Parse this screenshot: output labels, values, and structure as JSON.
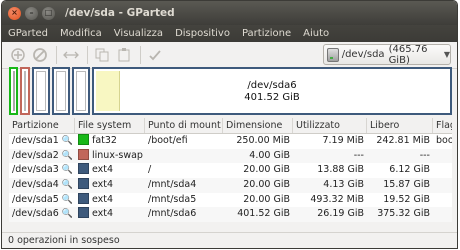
{
  "window": {
    "title": "/dev/sda - GParted"
  },
  "menu": [
    "GParted",
    "Modifica",
    "Visualizza",
    "Dispositivo",
    "Partizione",
    "Aiuto"
  ],
  "device": {
    "label": "/dev/sda",
    "size": "(465.76 GiB)"
  },
  "diskmap": {
    "name": "/dev/sda6",
    "size": "401.52 GiB"
  },
  "columns": [
    "Partizione",
    "File system",
    "Punto di mount",
    "Dimensione",
    "Utilizzato",
    "Libero",
    "Flag"
  ],
  "rows": [
    {
      "partition": "/dev/sda1",
      "fs": "fat32",
      "fs_color": "#18b818",
      "mount": "/boot/efi",
      "size": "250.00 MiB",
      "used": "7.19 MiB",
      "free": "242.81 MiB",
      "flag": "boot"
    },
    {
      "partition": "/dev/sda2",
      "fs": "linux-swap",
      "fs_color": "#c1665a",
      "mount": "",
      "size": "4.00 GiB",
      "used": "---",
      "free": "---",
      "flag": ""
    },
    {
      "partition": "/dev/sda3",
      "fs": "ext4",
      "fs_color": "#3e5a7c",
      "mount": "/",
      "size": "20.00 GiB",
      "used": "13.88 GiB",
      "free": "6.12 GiB",
      "flag": ""
    },
    {
      "partition": "/dev/sda4",
      "fs": "ext4",
      "fs_color": "#3e5a7c",
      "mount": "/mnt/sda4",
      "size": "20.00 GiB",
      "used": "4.13 GiB",
      "free": "15.87 GiB",
      "flag": ""
    },
    {
      "partition": "/dev/sda5",
      "fs": "ext4",
      "fs_color": "#3e5a7c",
      "mount": "/mnt/sda5",
      "size": "20.00 GiB",
      "used": "493.32 MiB",
      "free": "19.52 GiB",
      "flag": ""
    },
    {
      "partition": "/dev/sda6",
      "fs": "ext4",
      "fs_color": "#3e5a7c",
      "mount": "/mnt/sda6",
      "size": "401.52 GiB",
      "used": "26.19 GiB",
      "free": "375.32 GiB",
      "flag": ""
    }
  ],
  "status": "0 operazioni in sospeso",
  "colors": {
    "titlebar": "#3c3b37",
    "close": "#e0501d",
    "used_fill": "#f8f7c2"
  }
}
